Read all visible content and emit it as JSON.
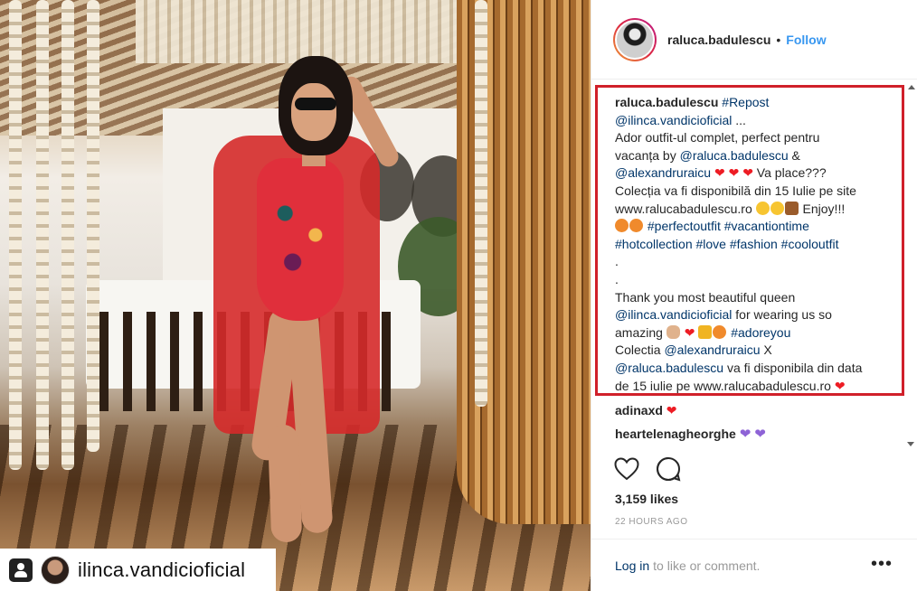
{
  "photo": {
    "repost_badge_name": "ilinca.vandicioficial"
  },
  "header": {
    "username": "raluca.badulescu",
    "separator": "•",
    "follow_label": "Follow"
  },
  "caption": {
    "author": "raluca.badulescu",
    "l1_hashtag": "#Repost",
    "l2_mention": "@ilinca.vandicioficial",
    "l2_rest": " ...",
    "l3": "Ador outfit-ul complet, perfect pentru",
    "l4_text": "vacanța by ",
    "l4_mention": "@raluca.badulescu",
    "l4_rest": " &",
    "l5_mention": "@alexandruraicu",
    "l5_rest": " Va place???",
    "l6": "Colecția va fi disponibilă din 15 Iulie pe site",
    "l7_text": "www.ralucabadulescu.ro",
    "l7_rest": " Enjoy!!!",
    "l8_tags": "#perfectoutfit #vacantiontime",
    "l9_tags": "#hotcollection #love #fashion #cooloutfit",
    "l10": ".",
    "l11": ".",
    "l12": "Thank you most beautiful queen",
    "l13_mention": "@ilinca.vandicioficial",
    "l13_rest": " for wearing us so",
    "l14_text": "amazing ",
    "l14_tag": "#adoreyou",
    "l15_text": "Colectia ",
    "l15_mention": "@alexandruraicu",
    "l15_rest": " X",
    "l16_mention": "@raluca.badulescu",
    "l16_rest": " va fi disponibila din data",
    "l17": "de 15 iulie pe www.ralucabadulescu.ro"
  },
  "comments": [
    {
      "user": "adinaxd",
      "text": ""
    },
    {
      "user": "heartelenagheorghe",
      "text": ""
    }
  ],
  "stats": {
    "likes": "3,159 likes",
    "time": "22 HOURS AGO"
  },
  "footer": {
    "login_link": "Log in",
    "login_rest": "to like or comment.",
    "more": "•••"
  },
  "colors": {
    "highlight_border": "#d0202a",
    "link": "#003569",
    "follow": "#3897f0"
  }
}
